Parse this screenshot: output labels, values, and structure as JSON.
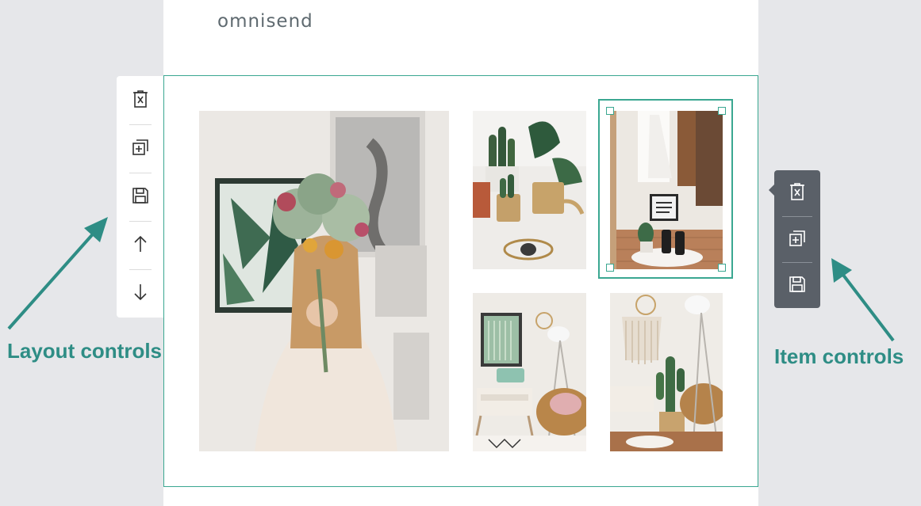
{
  "brand": {
    "logo_text": "omnisend"
  },
  "layout_controls": {
    "label": "Layout controls",
    "buttons": [
      {
        "name": "delete-layout-button",
        "icon": "delete-icon"
      },
      {
        "name": "duplicate-layout-button",
        "icon": "duplicate-icon"
      },
      {
        "name": "save-layout-button",
        "icon": "save-icon"
      },
      {
        "name": "move-up-button",
        "icon": "arrow-up-icon"
      },
      {
        "name": "move-down-button",
        "icon": "arrow-down-icon"
      }
    ]
  },
  "item_controls": {
    "label": "Item controls",
    "buttons": [
      {
        "name": "delete-item-button",
        "icon": "delete-icon"
      },
      {
        "name": "duplicate-item-button",
        "icon": "duplicate-icon"
      },
      {
        "name": "save-item-button",
        "icon": "save-icon"
      }
    ]
  },
  "colors": {
    "accent": "#3aa791",
    "callout_text": "#2e8d85",
    "item_toolbar_bg": "#5a6068",
    "page_bg": "#e6e7ea"
  }
}
